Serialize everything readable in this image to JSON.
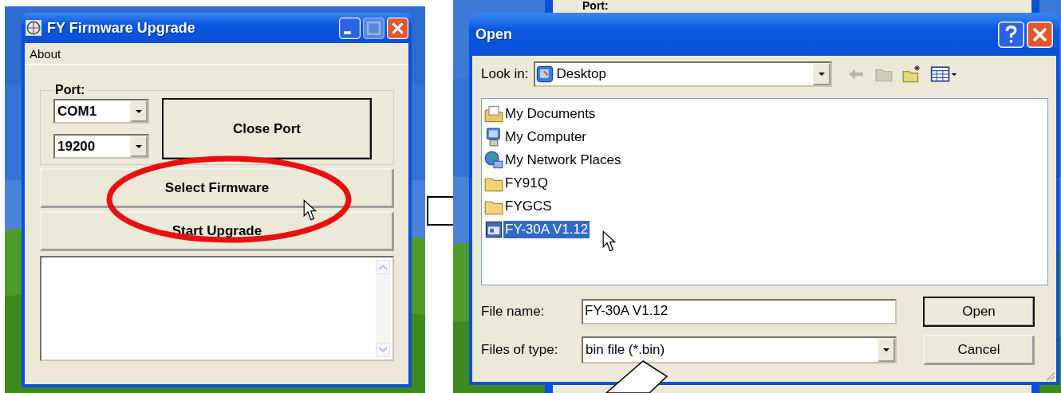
{
  "app_window": {
    "title": "FY Firmware Upgrade",
    "menu": [
      "About"
    ],
    "port_group": {
      "label": "Port:",
      "port": {
        "value": "COM1"
      },
      "baud": {
        "value": "19200"
      },
      "button": "Close Port"
    },
    "buttons": [
      "Select Firmware",
      "Start Upgrade"
    ]
  },
  "background_window": {
    "label": "Port:"
  },
  "open_dialog": {
    "title": "Open",
    "look_in": {
      "label": "Look in:",
      "value": "Desktop"
    },
    "files": [
      {
        "name": "My Documents",
        "kind": "documents",
        "selected": false
      },
      {
        "name": "My Computer",
        "kind": "computer",
        "selected": false
      },
      {
        "name": "My Network Places",
        "kind": "network",
        "selected": false
      },
      {
        "name": "FY91Q",
        "kind": "folder",
        "selected": false
      },
      {
        "name": "FYGCS",
        "kind": "folder",
        "selected": false
      },
      {
        "name": "FY-30A V1.12",
        "kind": "file",
        "selected": true
      }
    ],
    "file_name": {
      "label": "File name:",
      "value": "FY-30A V1.12"
    },
    "file_type": {
      "label": "Files of type:",
      "value": "bin file (*.bin)"
    },
    "buttons": [
      {
        "label": "Open",
        "default": true
      },
      {
        "label": "Cancel",
        "default": false
      }
    ]
  }
}
